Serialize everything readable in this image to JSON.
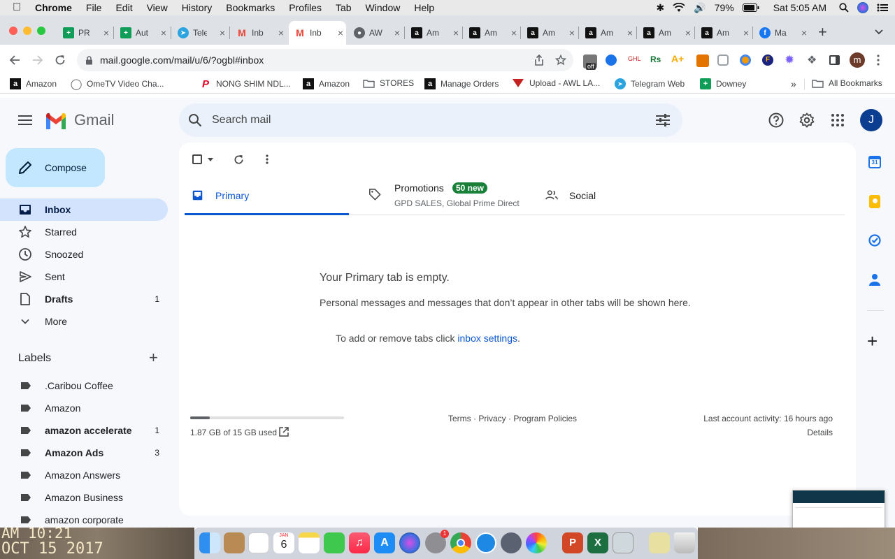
{
  "menubar": {
    "app": "Chrome",
    "items": [
      "File",
      "Edit",
      "View",
      "History",
      "Bookmarks",
      "Profiles",
      "Tab",
      "Window",
      "Help"
    ],
    "battery": "79%",
    "clock": "Sat 5:05 AM"
  },
  "tabs": [
    {
      "title": "PR",
      "icon": "sheets-icon"
    },
    {
      "title": "Aut",
      "icon": "sheets-icon"
    },
    {
      "title": "Tele",
      "icon": "telegram-icon"
    },
    {
      "title": "Inb",
      "icon": "gmail-icon"
    },
    {
      "title": "Inb",
      "icon": "gmail-icon",
      "active": true
    },
    {
      "title": "AW",
      "icon": "globe-icon"
    },
    {
      "title": "Am",
      "icon": "amazon-icon"
    },
    {
      "title": "Am",
      "icon": "amazon-icon"
    },
    {
      "title": "Am",
      "icon": "amazon-icon"
    },
    {
      "title": "Am",
      "icon": "amazon-icon"
    },
    {
      "title": "Am",
      "icon": "amazon-icon"
    },
    {
      "title": "Am",
      "icon": "amazon-icon"
    },
    {
      "title": "Ma",
      "icon": "facebook-icon"
    }
  ],
  "omnibox": {
    "url": "mail.google.com/mail/u/6/?ogbl#inbox"
  },
  "profile_initial": "m",
  "extension_badge": "off",
  "bookmarks": [
    {
      "label": "Amazon",
      "icon": "amazon-icon"
    },
    {
      "label": "OmeTV Video Cha...",
      "icon": "globe-icon"
    },
    {
      "label": "NONG SHIM NDL...",
      "icon": "pinterest-icon"
    },
    {
      "label": "Amazon",
      "icon": "amazon-icon"
    },
    {
      "label": "STORES",
      "icon": "folder-icon"
    },
    {
      "label": "Manage Orders",
      "icon": "amazon-icon"
    },
    {
      "label": "Upload - AWL LA...",
      "icon": "awl-icon"
    },
    {
      "label": "Telegram Web",
      "icon": "telegram-icon"
    },
    {
      "label": "Downey",
      "icon": "sheets-icon"
    }
  ],
  "all_bookmarks": "All Bookmarks",
  "gmail": {
    "logo": "Gmail",
    "search_placeholder": "Search mail",
    "avatar": "J",
    "compose": "Compose",
    "nav": [
      {
        "label": "Inbox",
        "icon": "inbox-icon",
        "count": "",
        "active": true
      },
      {
        "label": "Starred",
        "icon": "star-icon",
        "count": ""
      },
      {
        "label": "Snoozed",
        "icon": "clock-icon",
        "count": ""
      },
      {
        "label": "Sent",
        "icon": "send-icon",
        "count": ""
      },
      {
        "label": "Drafts",
        "icon": "draft-icon",
        "count": "1",
        "bold": true
      },
      {
        "label": "More",
        "icon": "chevron-down-icon",
        "count": ""
      }
    ],
    "labels_title": "Labels",
    "labels": [
      {
        "label": ".Caribou Coffee",
        "count": ""
      },
      {
        "label": "Amazon",
        "count": ""
      },
      {
        "label": "amazon accelerate",
        "count": "1",
        "bold": true
      },
      {
        "label": "Amazon Ads",
        "count": "3",
        "bold": true
      },
      {
        "label": "Amazon Answers",
        "count": ""
      },
      {
        "label": "Amazon Business",
        "count": ""
      },
      {
        "label": "amazon corporate",
        "count": ""
      }
    ],
    "category_tabs": {
      "primary": "Primary",
      "promotions": "Promotions",
      "promotions_badge": "50 new",
      "promotions_sub": "GPD SALES, Global Prime Direct",
      "social": "Social"
    },
    "empty": {
      "title": "Your Primary tab is empty.",
      "line1": "Personal messages and messages that don’t appear in other tabs will be shown here.",
      "line2_prefix": "To add or remove tabs click ",
      "line2_link": "inbox settings",
      "line2_suffix": "."
    },
    "storage": {
      "text": "1.87 GB of 15 GB used",
      "fraction": 0.125
    },
    "footer_links": [
      "Terms",
      "Privacy",
      "Program Policies"
    ],
    "last_activity": "Last account activity: 16 hours ago",
    "details": "Details"
  },
  "desktop": {
    "timestamp_line1": "AM 10:21",
    "timestamp_line2": "OCT 15 2017"
  },
  "dock": {
    "calendar_day": "6",
    "calendar_month": "JAN",
    "settings_badge": "1"
  }
}
